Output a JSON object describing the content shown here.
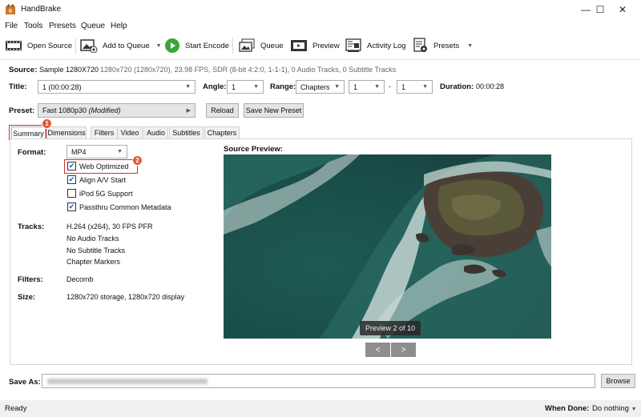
{
  "window": {
    "title": "HandBrake",
    "minimize": "—",
    "maximize": "☐",
    "close": "✕"
  },
  "menu": [
    "File",
    "Tools",
    "Presets",
    "Queue",
    "Help"
  ],
  "toolbar": {
    "open_source": "Open Source",
    "add_to_queue": "Add to Queue",
    "start_encode": "Start Encode",
    "queue": "Queue",
    "preview": "Preview",
    "activity_log": "Activity Log",
    "presets": "Presets"
  },
  "source": {
    "label": "Source:",
    "name": "Sample 1280X720",
    "details": "1280x720 (1280x720), 23.98 FPS, SDR (8-bit 4:2:0, 1-1-1), 0 Audio Tracks, 0 Subtitle Tracks"
  },
  "title_row": {
    "title_label": "Title:",
    "title_value": "1  (00:00:28)",
    "angle_label": "Angle:",
    "angle_value": "1",
    "range_label": "Range:",
    "range_value": "Chapters",
    "range_start": "1",
    "range_dash": "-",
    "range_end": "1",
    "duration_label": "Duration:",
    "duration_value": "00:00:28"
  },
  "preset_row": {
    "label": "Preset:",
    "value": "Fast 1080p30",
    "modified": "(Modified)",
    "reload": "Reload",
    "save_new": "Save New Preset"
  },
  "tabs": [
    "Summary",
    "Dimensions",
    "Filters",
    "Video",
    "Audio",
    "Subtitles",
    "Chapters"
  ],
  "summary": {
    "format_label": "Format:",
    "format_value": "MP4",
    "checkboxes": [
      {
        "label": "Web Optimized",
        "checked": true
      },
      {
        "label": "Align A/V Start",
        "checked": true
      },
      {
        "label": "iPod 5G Support",
        "checked": false
      },
      {
        "label": "Passthru Common Metadata",
        "checked": true
      }
    ],
    "tracks_label": "Tracks:",
    "tracks": [
      "H.264 (x264), 30 FPS PFR",
      "No Audio Tracks",
      "No Subtitle Tracks",
      "Chapter Markers"
    ],
    "filters_label": "Filters:",
    "filters_value": "Decomb",
    "size_label": "Size:",
    "size_value": "1280x720 storage, 1280x720 display",
    "preview_label": "Source Preview:",
    "preview_badge": "Preview 2 of 10",
    "prev_btn": "<",
    "next_btn": ">"
  },
  "annotations": {
    "badge1": "1",
    "badge2": "2",
    "color": "#d9302c"
  },
  "save_as": {
    "label": "Save As:",
    "browse": "Browse"
  },
  "status": {
    "text": "Ready",
    "when_done_label": "When Done:",
    "when_done_value": "Do nothing"
  }
}
